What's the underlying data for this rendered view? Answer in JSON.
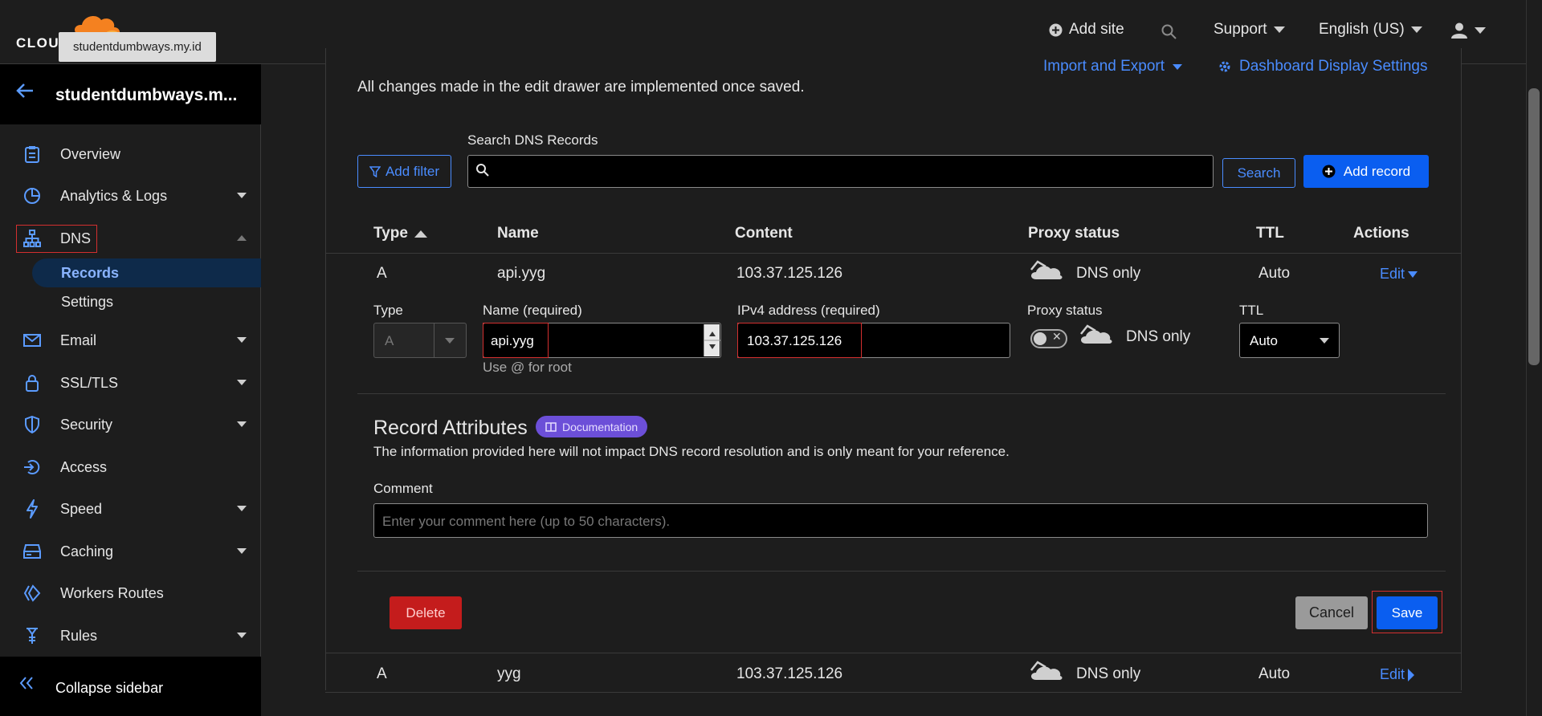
{
  "header": {
    "logo_text": "CLOU",
    "tooltip": "studentdumbways.my.id",
    "add_site": "Add site",
    "support": "Support",
    "language": "English (US)"
  },
  "sidebar": {
    "zone_name": "studentdumbways.m...",
    "items": [
      {
        "label": "Overview",
        "icon": "clipboard-icon",
        "dropdown": false
      },
      {
        "label": "Analytics & Logs",
        "icon": "pie-chart-icon",
        "dropdown": true
      },
      {
        "label": "DNS",
        "icon": "network-icon",
        "dropdown": "expanded"
      },
      {
        "label": "Email",
        "icon": "envelope-icon",
        "dropdown": true
      },
      {
        "label": "SSL/TLS",
        "icon": "lock-icon",
        "dropdown": true
      },
      {
        "label": "Security",
        "icon": "shield-icon",
        "dropdown": true
      },
      {
        "label": "Access",
        "icon": "access-icon",
        "dropdown": false
      },
      {
        "label": "Speed",
        "icon": "lightning-icon",
        "dropdown": true
      },
      {
        "label": "Caching",
        "icon": "server-icon",
        "dropdown": true
      },
      {
        "label": "Workers Routes",
        "icon": "workers-icon",
        "dropdown": false
      },
      {
        "label": "Rules",
        "icon": "rules-icon",
        "dropdown": true
      }
    ],
    "dns_sub": {
      "records": "Records",
      "settings": "Settings"
    },
    "collapse": "Collapse sidebar"
  },
  "main": {
    "description": "All changes made in the edit drawer are implemented once saved.",
    "import_export": "Import and Export",
    "dashboard_settings": "Dashboard Display Settings",
    "search_label": "Search DNS Records",
    "add_filter": "Add filter",
    "search_button": "Search",
    "add_record": "Add record",
    "columns": {
      "type": "Type",
      "name": "Name",
      "content": "Content",
      "proxy": "Proxy status",
      "ttl": "TTL",
      "actions": "Actions"
    },
    "rows": [
      {
        "type": "A",
        "name": "api.yyg",
        "content": "103.37.125.126",
        "proxy": "DNS only",
        "ttl": "Auto",
        "action": "Edit"
      },
      {
        "type": "A",
        "name": "yyg",
        "content": "103.37.125.126",
        "proxy": "DNS only",
        "ttl": "Auto",
        "action": "Edit"
      }
    ],
    "edit_form": {
      "type_label": "Type",
      "type_value": "A",
      "name_label": "Name (required)",
      "name_value": "api.yyg",
      "name_hint": "Use @ for root",
      "ip_label": "IPv4 address (required)",
      "ip_value": "103.37.125.126",
      "proxy_label": "Proxy status",
      "proxy_value": "DNS only",
      "ttl_label": "TTL",
      "ttl_value": "Auto"
    },
    "attributes": {
      "title": "Record Attributes",
      "doc_badge": "Documentation",
      "description": "The information provided here will not impact DNS record resolution and is only meant for your reference.",
      "comment_label": "Comment",
      "comment_placeholder": "Enter your comment here (up to 50 characters)."
    },
    "buttons": {
      "delete": "Delete",
      "cancel": "Cancel",
      "save": "Save"
    }
  },
  "colors": {
    "accent": "#0a5ef0",
    "link": "#4a8cff",
    "danger": "#c41c1c",
    "highlight_box": "#d32f2f"
  }
}
